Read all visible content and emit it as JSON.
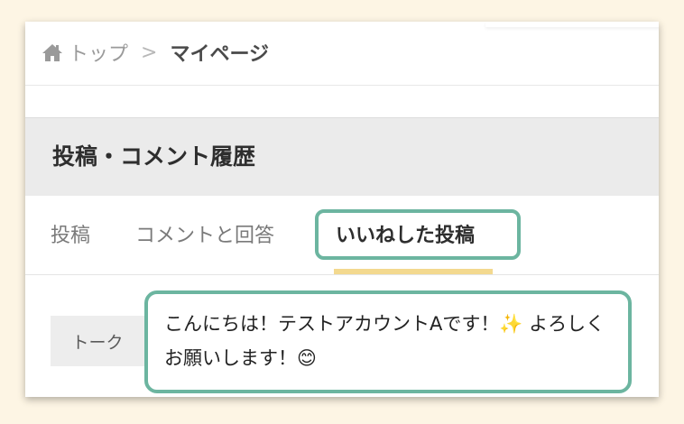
{
  "breadcrumb": {
    "home_label": "トップ",
    "separator": ">",
    "current": "マイページ"
  },
  "section": {
    "title": "投稿・コメント履歴"
  },
  "tabs": [
    {
      "label": "投稿",
      "active": false
    },
    {
      "label": "コメントと回答",
      "active": false
    },
    {
      "label": "いいねした投稿",
      "active": true
    }
  ],
  "post": {
    "category": "トーク",
    "message": "こんにちは！テストアカウントAです！✨ よろしくお願いします！😊"
  },
  "colors": {
    "background": "#fdf5e4",
    "highlight_border": "#6cb5a0",
    "active_tab_underline": "#f3d98f"
  },
  "icons": {
    "home": "home-icon"
  }
}
